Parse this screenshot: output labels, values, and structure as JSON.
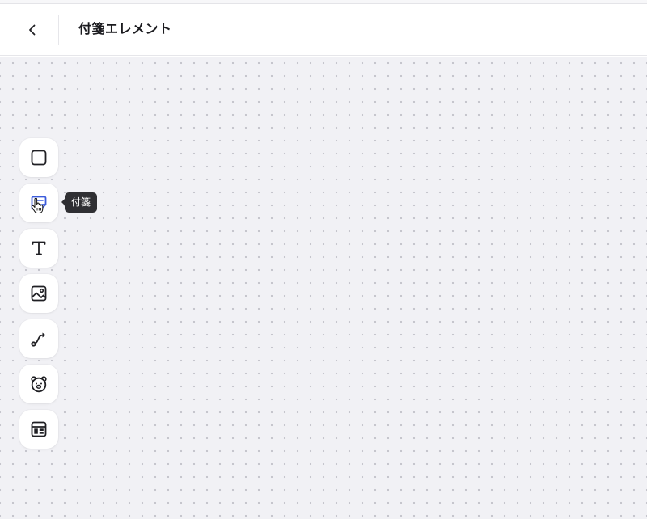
{
  "header": {
    "title": "付箋エレメント"
  },
  "toolbar": {
    "tools": [
      {
        "name": "square",
        "icon": "square-icon"
      },
      {
        "name": "sticky-note",
        "icon": "sticky-note-icon",
        "tooltip": "付箋",
        "active": true
      },
      {
        "name": "text",
        "icon": "text-icon"
      },
      {
        "name": "image",
        "icon": "image-icon"
      },
      {
        "name": "connector",
        "icon": "connector-icon"
      },
      {
        "name": "stamp",
        "icon": "bear-icon"
      },
      {
        "name": "template",
        "icon": "template-icon"
      }
    ]
  },
  "tooltip": {
    "label": "付箋"
  },
  "colors": {
    "accent": "#3b5bdb",
    "icon": "#1f1f23",
    "canvas": "#f1f1f5",
    "tooltip_bg": "#2f2f33"
  }
}
